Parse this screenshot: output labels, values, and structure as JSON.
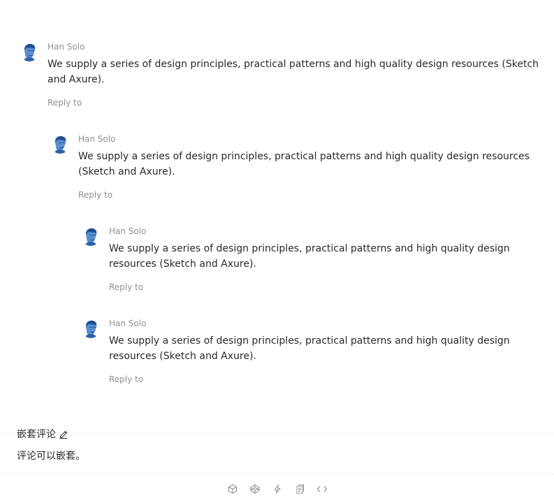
{
  "comments": [
    {
      "author": "Han Solo",
      "text": "We supply a series of design principles, practical patterns and high quality design resources (Sketch and Axure).",
      "reply": "Reply to"
    },
    {
      "author": "Han Solo",
      "text": "We supply a series of design principles, practical patterns and high quality design resources (Sketch and Axure).",
      "reply": "Reply to"
    },
    {
      "author": "Han Solo",
      "text": "We supply a series of design principles, practical patterns and high quality design resources (Sketch and Axure).",
      "reply": "Reply to"
    },
    {
      "author": "Han Solo",
      "text": "We supply a series of design principles, practical patterns and high quality design resources (Sketch and Axure).",
      "reply": "Reply to"
    }
  ],
  "meta": {
    "title": "嵌套评论",
    "description": "评论可以嵌套。"
  },
  "toolbar": {
    "icons": [
      "codesandbox-icon",
      "codepen-icon",
      "thunderbolt-icon",
      "copy-icon",
      "code-icon"
    ]
  },
  "colors": {
    "text": "#262626",
    "secondary": "#8c8c8c",
    "divider": "#f0f0f0",
    "icon": "#8c8c8c",
    "avatar": "#1f5fae"
  }
}
